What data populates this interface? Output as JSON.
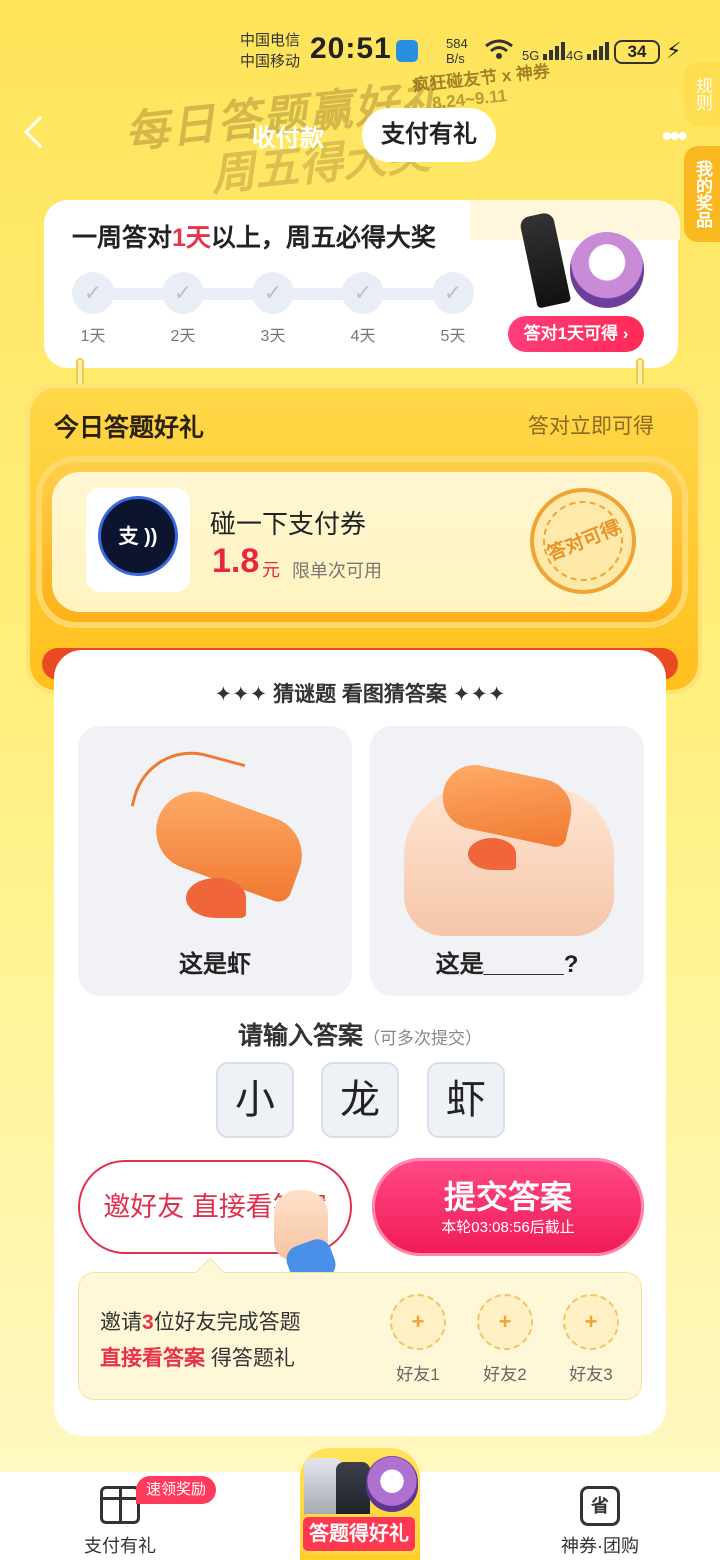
{
  "status_bar": {
    "carrier1": "中国电信",
    "carrier2": "中国移动",
    "time": "20:51",
    "net_speed_value": "584",
    "net_speed_unit": "B/s",
    "sig1": "5G",
    "sig2": "4G",
    "battery": "34"
  },
  "banner": {
    "title": "每日答题赢好礼",
    "subtitle": "周五得大奖",
    "festival": "疯狂碰友节 x 神券",
    "dates": "8.24~9.11"
  },
  "nav": {
    "tab_pay": "收付款",
    "tab_gift": "支付有礼",
    "side_rules": "规则",
    "side_prizes": "我的奖品"
  },
  "week": {
    "title_prefix": "一周答对",
    "title_highlight": "1天",
    "title_suffix": "以上，周五必得大奖",
    "days": [
      "1天",
      "2天",
      "3天",
      "4天",
      "5天"
    ],
    "prize_tag": "答对1天可得 ›"
  },
  "reward": {
    "title": "今日答题好礼",
    "subtitle": "答对立即可得",
    "logo_text": "支",
    "coupon_name": "碰一下支付券",
    "coupon_amount": "1.8",
    "coupon_unit": "元",
    "coupon_limit": "限单次可用",
    "stamp": "答对可得"
  },
  "quiz": {
    "header": "✦✦✦ 猜谜题 看图猜答案 ✦✦✦",
    "left_caption": "这是虾",
    "right_caption": "这是______?",
    "prompt": "请输入答案",
    "prompt_hint": "（可多次提交）",
    "chars": [
      "小",
      "龙",
      "虾"
    ],
    "invite_button": "邀好友 直接看答案",
    "submit_button": "提交答案",
    "submit_sub": "本轮03:08:56后截止"
  },
  "invite": {
    "line1_prefix": "邀请",
    "line1_count": "3",
    "line1_suffix": "位好友完成答题",
    "line2_highlight": "直接看答案",
    "line2_suffix": " 得答题礼",
    "friends": [
      "好友1",
      "好友2",
      "好友3"
    ],
    "plus": "+"
  },
  "bottom_nav": {
    "left_label": "支付有礼",
    "left_badge": "速领奖励",
    "center_label": "答题得好礼",
    "right_icon": "省",
    "right_label": "神券·团购"
  },
  "icons": {
    "back": "chevron-left-icon",
    "more": "more-dots-icon",
    "check": "check-icon",
    "gift": "gift-icon",
    "coupon": "coupon-icon"
  },
  "colors": {
    "accent_red": "#e8324a",
    "submit_pink": "#f01a56",
    "background_yellow": "#ffe45a"
  }
}
